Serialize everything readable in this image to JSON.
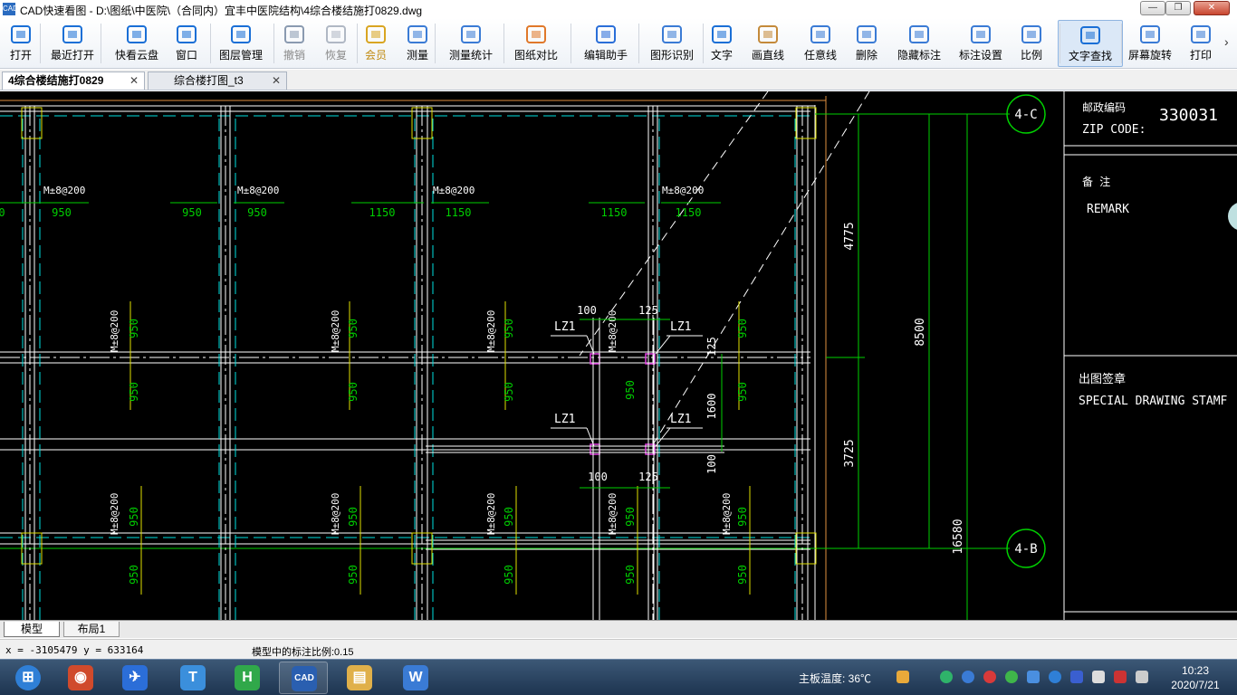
{
  "window": {
    "title": "CAD快速看图 - D:\\图纸\\中医院\\（合同内）宜丰中医院结构\\4综合楼结施打0829.dwg",
    "app_icon_text": "CAD"
  },
  "toolbar": {
    "buttons": [
      {
        "label": "打开",
        "icon": "folder-open-icon"
      },
      {
        "label": "最近打开",
        "icon": "recent-clock-icon"
      },
      {
        "label": "快看云盘",
        "icon": "cloud-icon"
      },
      {
        "label": "窗口",
        "icon": "window-frame-icon"
      },
      {
        "label": "图层管理",
        "icon": "layers-icon"
      },
      {
        "label": "撤销",
        "icon": "undo-arrow-icon"
      },
      {
        "label": "恢复",
        "icon": "redo-arrow-icon"
      },
      {
        "label": "会员",
        "icon": "vip-badge-icon"
      },
      {
        "label": "测量",
        "icon": "ruler-icon"
      },
      {
        "label": "测量统计",
        "icon": "measure-stats-icon"
      },
      {
        "label": "图纸对比",
        "icon": "compare-icon"
      },
      {
        "label": "编辑助手",
        "icon": "edit-assistant-icon"
      },
      {
        "label": "图形识别",
        "icon": "shape-recognize-icon"
      },
      {
        "label": "文字",
        "icon": "text-t-icon"
      },
      {
        "label": "画直线",
        "icon": "line-icon"
      },
      {
        "label": "任意线",
        "icon": "pen-icon"
      },
      {
        "label": "删除",
        "icon": "eraser-icon"
      },
      {
        "label": "隐藏标注",
        "icon": "hide-eye-icon"
      },
      {
        "label": "标注设置",
        "icon": "annotation-settings-icon"
      },
      {
        "label": "比例",
        "icon": "scale-ab-icon"
      },
      {
        "label": "文字查找",
        "icon": "text-search-icon"
      },
      {
        "label": "屏幕旋转",
        "icon": "rotate-screen-icon"
      },
      {
        "label": "打印",
        "icon": "printer-icon"
      }
    ],
    "more": "›"
  },
  "file_tabs": [
    {
      "label": "4综合楼结施打0829",
      "close": "✕"
    },
    {
      "label": "综合楼打图_t3",
      "close": "✕"
    }
  ],
  "drawing": {
    "rebar_label": "M±8@200",
    "dims_top": [
      "0",
      "950",
      "950",
      "950",
      "1150",
      "1150",
      "1150",
      "1150"
    ],
    "dim_950": "950",
    "lz1": "LZ1",
    "dim_100": "100",
    "dim_125": "125",
    "dim_1600": "1600",
    "dim_4775": "4775",
    "dim_8500": "8500",
    "dim_3725": "3725",
    "dim_16580": "16580",
    "axis_4c": "4-C",
    "axis_4b": "4-B",
    "titleblock": {
      "zip_cn": "邮政编码",
      "zip_en": "ZIP CODE:",
      "zip_value": "330031",
      "remark_cn": "备    注",
      "remark_en": "REMARK",
      "stamp_cn": "出图签章",
      "stamp_en": "SPECIAL DRAWING STAMF"
    }
  },
  "layout_tabs": [
    "模型",
    "布局1"
  ],
  "status": {
    "coords": "x = -3105479  y = 633164",
    "scale_text": "模型中的标注比例:0.15"
  },
  "taskbar": {
    "apps": [
      {
        "name": "start-button",
        "glyph": "⊞",
        "color": "#2f7fd6"
      },
      {
        "name": "chrome",
        "glyph": "◉",
        "color": "#d04a2c"
      },
      {
        "name": "feishu",
        "glyph": "✈",
        "color": "#2b6ed8"
      },
      {
        "name": "typora",
        "glyph": "T",
        "color": "#3b8fdc"
      },
      {
        "name": "hbuilder",
        "glyph": "H",
        "color": "#30a84a"
      },
      {
        "name": "cad-viewer",
        "glyph": "CAD",
        "color": "#2a5fb0"
      },
      {
        "name": "file-explorer",
        "glyph": "▤",
        "color": "#e0b04a"
      },
      {
        "name": "wps",
        "glyph": "W",
        "color": "#3a7bd5"
      }
    ],
    "temp": "主板温度: 36℃",
    "time": "10:23",
    "date": "2020/7/21"
  }
}
